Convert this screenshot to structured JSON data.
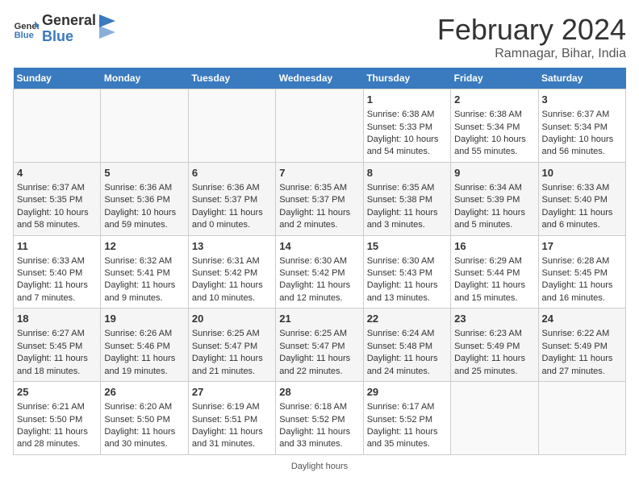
{
  "header": {
    "logo_line1": "General",
    "logo_line2": "Blue",
    "main_title": "February 2024",
    "subtitle": "Ramnagar, Bihar, India"
  },
  "days_of_week": [
    "Sunday",
    "Monday",
    "Tuesday",
    "Wednesday",
    "Thursday",
    "Friday",
    "Saturday"
  ],
  "footer_label": "Daylight hours",
  "weeks": [
    [
      {
        "day": "",
        "content": ""
      },
      {
        "day": "",
        "content": ""
      },
      {
        "day": "",
        "content": ""
      },
      {
        "day": "",
        "content": ""
      },
      {
        "day": "1",
        "content": "Sunrise: 6:38 AM\nSunset: 5:33 PM\nDaylight: 10 hours and 54 minutes."
      },
      {
        "day": "2",
        "content": "Sunrise: 6:38 AM\nSunset: 5:34 PM\nDaylight: 10 hours and 55 minutes."
      },
      {
        "day": "3",
        "content": "Sunrise: 6:37 AM\nSunset: 5:34 PM\nDaylight: 10 hours and 56 minutes."
      }
    ],
    [
      {
        "day": "4",
        "content": "Sunrise: 6:37 AM\nSunset: 5:35 PM\nDaylight: 10 hours and 58 minutes."
      },
      {
        "day": "5",
        "content": "Sunrise: 6:36 AM\nSunset: 5:36 PM\nDaylight: 10 hours and 59 minutes."
      },
      {
        "day": "6",
        "content": "Sunrise: 6:36 AM\nSunset: 5:37 PM\nDaylight: 11 hours and 0 minutes."
      },
      {
        "day": "7",
        "content": "Sunrise: 6:35 AM\nSunset: 5:37 PM\nDaylight: 11 hours and 2 minutes."
      },
      {
        "day": "8",
        "content": "Sunrise: 6:35 AM\nSunset: 5:38 PM\nDaylight: 11 hours and 3 minutes."
      },
      {
        "day": "9",
        "content": "Sunrise: 6:34 AM\nSunset: 5:39 PM\nDaylight: 11 hours and 5 minutes."
      },
      {
        "day": "10",
        "content": "Sunrise: 6:33 AM\nSunset: 5:40 PM\nDaylight: 11 hours and 6 minutes."
      }
    ],
    [
      {
        "day": "11",
        "content": "Sunrise: 6:33 AM\nSunset: 5:40 PM\nDaylight: 11 hours and 7 minutes."
      },
      {
        "day": "12",
        "content": "Sunrise: 6:32 AM\nSunset: 5:41 PM\nDaylight: 11 hours and 9 minutes."
      },
      {
        "day": "13",
        "content": "Sunrise: 6:31 AM\nSunset: 5:42 PM\nDaylight: 11 hours and 10 minutes."
      },
      {
        "day": "14",
        "content": "Sunrise: 6:30 AM\nSunset: 5:42 PM\nDaylight: 11 hours and 12 minutes."
      },
      {
        "day": "15",
        "content": "Sunrise: 6:30 AM\nSunset: 5:43 PM\nDaylight: 11 hours and 13 minutes."
      },
      {
        "day": "16",
        "content": "Sunrise: 6:29 AM\nSunset: 5:44 PM\nDaylight: 11 hours and 15 minutes."
      },
      {
        "day": "17",
        "content": "Sunrise: 6:28 AM\nSunset: 5:45 PM\nDaylight: 11 hours and 16 minutes."
      }
    ],
    [
      {
        "day": "18",
        "content": "Sunrise: 6:27 AM\nSunset: 5:45 PM\nDaylight: 11 hours and 18 minutes."
      },
      {
        "day": "19",
        "content": "Sunrise: 6:26 AM\nSunset: 5:46 PM\nDaylight: 11 hours and 19 minutes."
      },
      {
        "day": "20",
        "content": "Sunrise: 6:25 AM\nSunset: 5:47 PM\nDaylight: 11 hours and 21 minutes."
      },
      {
        "day": "21",
        "content": "Sunrise: 6:25 AM\nSunset: 5:47 PM\nDaylight: 11 hours and 22 minutes."
      },
      {
        "day": "22",
        "content": "Sunrise: 6:24 AM\nSunset: 5:48 PM\nDaylight: 11 hours and 24 minutes."
      },
      {
        "day": "23",
        "content": "Sunrise: 6:23 AM\nSunset: 5:49 PM\nDaylight: 11 hours and 25 minutes."
      },
      {
        "day": "24",
        "content": "Sunrise: 6:22 AM\nSunset: 5:49 PM\nDaylight: 11 hours and 27 minutes."
      }
    ],
    [
      {
        "day": "25",
        "content": "Sunrise: 6:21 AM\nSunset: 5:50 PM\nDaylight: 11 hours and 28 minutes."
      },
      {
        "day": "26",
        "content": "Sunrise: 6:20 AM\nSunset: 5:50 PM\nDaylight: 11 hours and 30 minutes."
      },
      {
        "day": "27",
        "content": "Sunrise: 6:19 AM\nSunset: 5:51 PM\nDaylight: 11 hours and 31 minutes."
      },
      {
        "day": "28",
        "content": "Sunrise: 6:18 AM\nSunset: 5:52 PM\nDaylight: 11 hours and 33 minutes."
      },
      {
        "day": "29",
        "content": "Sunrise: 6:17 AM\nSunset: 5:52 PM\nDaylight: 11 hours and 35 minutes."
      },
      {
        "day": "",
        "content": ""
      },
      {
        "day": "",
        "content": ""
      }
    ]
  ]
}
